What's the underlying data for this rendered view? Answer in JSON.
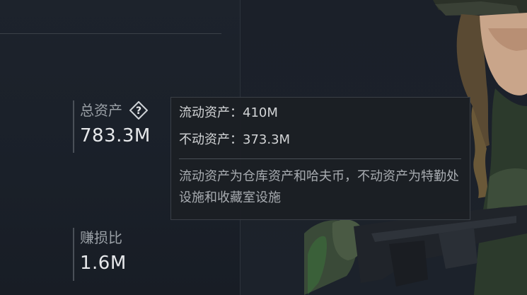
{
  "stats": {
    "total_assets": {
      "label": "总资产",
      "value": "783.3M",
      "help_glyph": "?"
    },
    "profit_ratio": {
      "label": "赚损比",
      "value": "1.6M"
    }
  },
  "tooltip": {
    "liquid_assets": "流动资产：410M",
    "fixed_assets": "不动资产：373.3M",
    "description": "流动资产为仓库资产和哈夫币，不动资产为特勤处设施和收藏室设施"
  },
  "icons": {
    "help": "question-diamond-icon"
  }
}
